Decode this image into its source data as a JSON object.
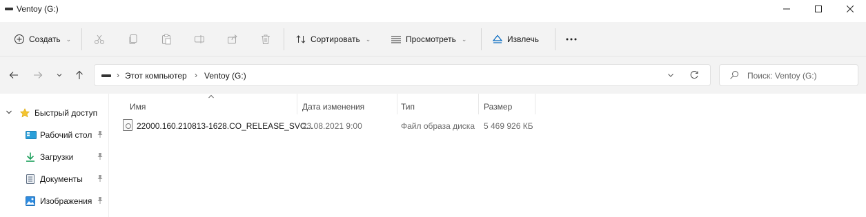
{
  "window": {
    "title": "Ventoy (G:)"
  },
  "toolbar": {
    "create_label": "Создать",
    "sort_label": "Сортировать",
    "view_label": "Просмотреть",
    "eject_label": "Извлечь"
  },
  "address": {
    "crumbs": [
      "Этот компьютер",
      "Ventoy (G:)"
    ]
  },
  "search": {
    "placeholder": "Поиск: Ventoy (G:)"
  },
  "sidebar": {
    "quick_access": "Быстрый доступ",
    "items": [
      {
        "label": "Рабочий стол",
        "icon": "desktop-icon"
      },
      {
        "label": "Загрузки",
        "icon": "download-icon"
      },
      {
        "label": "Документы",
        "icon": "documents-icon"
      },
      {
        "label": "Изображения",
        "icon": "pictures-icon"
      }
    ]
  },
  "columns": {
    "name": "Имя",
    "modified": "Дата изменения",
    "type": "Тип",
    "size": "Размер"
  },
  "files": [
    {
      "name": "22000.160.210813-1628.CO_RELEASE_SVC...",
      "modified": "23.08.2021 9:00",
      "type": "Файл образа диска",
      "size": "5 469 926 КБ"
    }
  ],
  "colors": {
    "accent": "#0067c0",
    "star": "#f4c430"
  }
}
